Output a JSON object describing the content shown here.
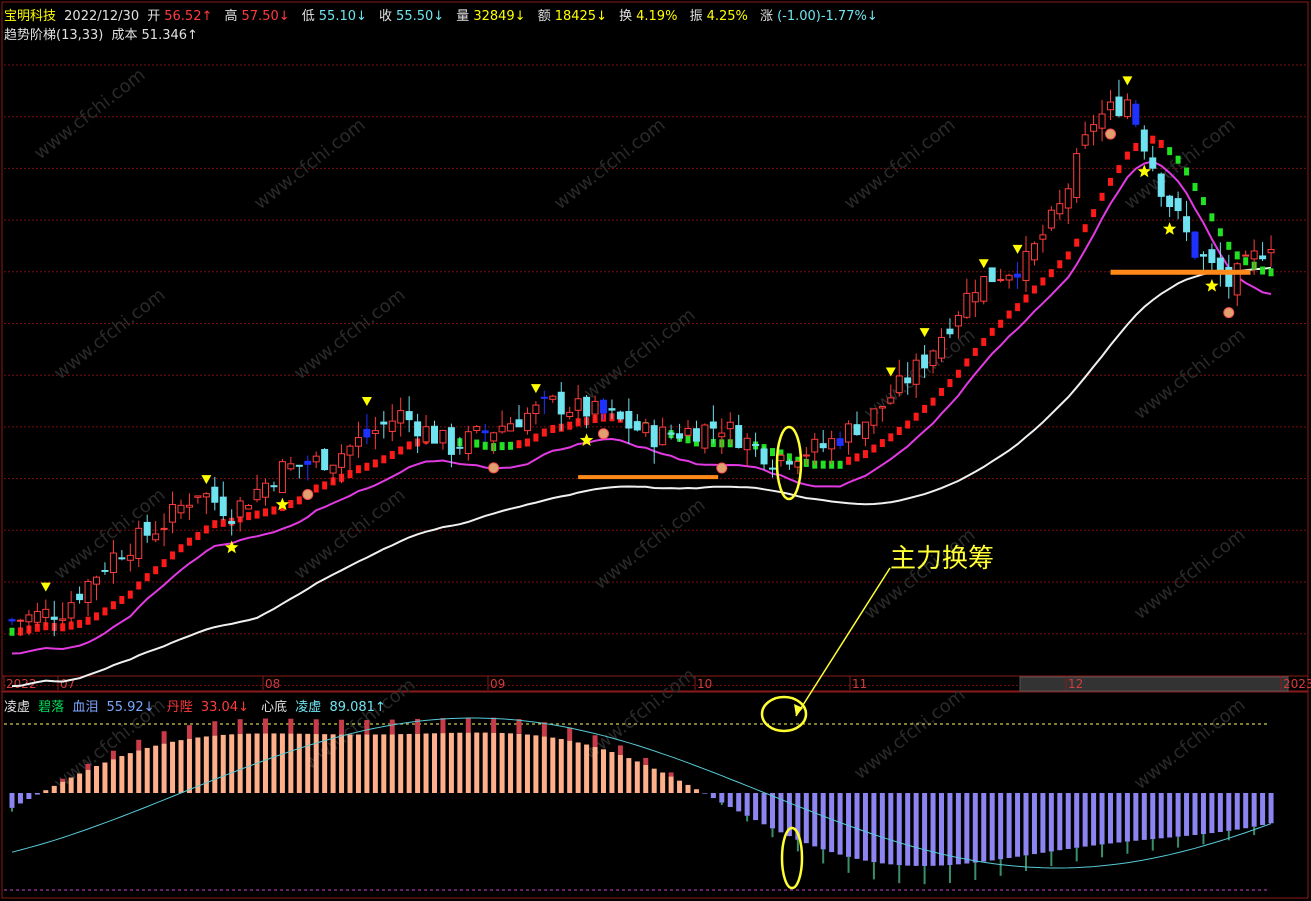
{
  "header": {
    "stock_name": "宝明科技",
    "date": "2022/12/30",
    "open_label": "开",
    "open": "56.52↑",
    "high_label": "高",
    "high": "57.50↓",
    "low_label": "低",
    "low": "55.10↓",
    "close_label": "收",
    "close": "55.50↓",
    "volume_label": "量",
    "volume": "32849↓",
    "amount_label": "额",
    "amount": "18425↓",
    "turnover_label": "换",
    "turnover": "4.19%",
    "amplitude_label": "振",
    "amplitude": "4.25%",
    "change_label": "涨",
    "change": "(-1.00)-1.77%↓"
  },
  "indicator_main": {
    "name": "趋势阶梯(13,33)",
    "cost_label": "成本",
    "cost_value": "51.346↑"
  },
  "x_axis": {
    "labels": [
      "2022",
      "07",
      "08",
      "09",
      "10",
      "11",
      "12",
      "2023"
    ]
  },
  "indicator_sub": {
    "name": "凌虚",
    "lines": [
      {
        "label": "碧落",
        "value": ""
      },
      {
        "label": "血泪",
        "value": "55.92↓"
      },
      {
        "label": "丹陛",
        "value": "33.04↓"
      },
      {
        "label": "心底",
        "value": ""
      },
      {
        "label": "凌虚",
        "value": "89.081↑"
      }
    ]
  },
  "annotation": "主力换筹",
  "watermark": "www.cfchi.com",
  "colors": {
    "up": "#ff3c3c",
    "down_cyan": "#6fe3f0",
    "down_blue": "#1e32ff",
    "ma_pink": "#e23ae2",
    "ma_white": "#f0f0f0",
    "step_red": "#ff1a1a",
    "step_green": "#22e022",
    "sub_salmon": "#ffb08a",
    "sub_violet": "#8c84f0",
    "sub_red": "#c83c4a",
    "sub_teal": "#3a8f6a",
    "sub_line": "#56cbd6",
    "grid": "#7a0f0f",
    "highlight": "#ffff33"
  }
}
